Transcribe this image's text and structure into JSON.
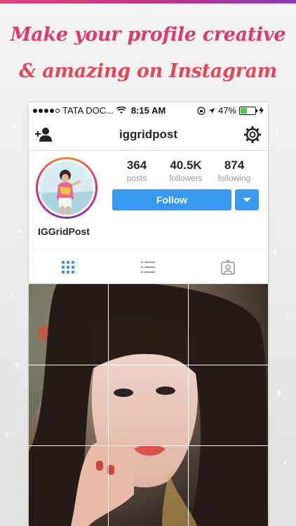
{
  "headline": {
    "line1": "Make your profile creative",
    "line2": "& amazing on Instagram"
  },
  "status_bar": {
    "carrier": "TATA DOC...",
    "time": "8:15 AM",
    "battery": "47%",
    "battery_level": 0.47,
    "icons": [
      "signal-dots-icon",
      "wifi-icon",
      "lock-rotation-icon",
      "location-icon",
      "battery-icon",
      "charging-icon"
    ]
  },
  "nav": {
    "title": "iggridpost",
    "left_icon": "add-person-icon",
    "right_icon": "gear-icon"
  },
  "profile": {
    "username": "IGGridPost",
    "stats": [
      {
        "value": "364",
        "label": "posts"
      },
      {
        "value": "40.5K",
        "label": "followers"
      },
      {
        "value": "874",
        "label": "following"
      }
    ],
    "follow_label": "Follow"
  },
  "tabs": [
    {
      "icon": "grid-icon",
      "active": true
    },
    {
      "icon": "list-icon",
      "active": false
    },
    {
      "icon": "tagged-icon",
      "active": false
    }
  ],
  "colors": {
    "headline_top": "#d93d6e",
    "headline_bottom": "#e0485a",
    "follow_blue": "#3897f0",
    "active_tab": "#3897f0"
  }
}
